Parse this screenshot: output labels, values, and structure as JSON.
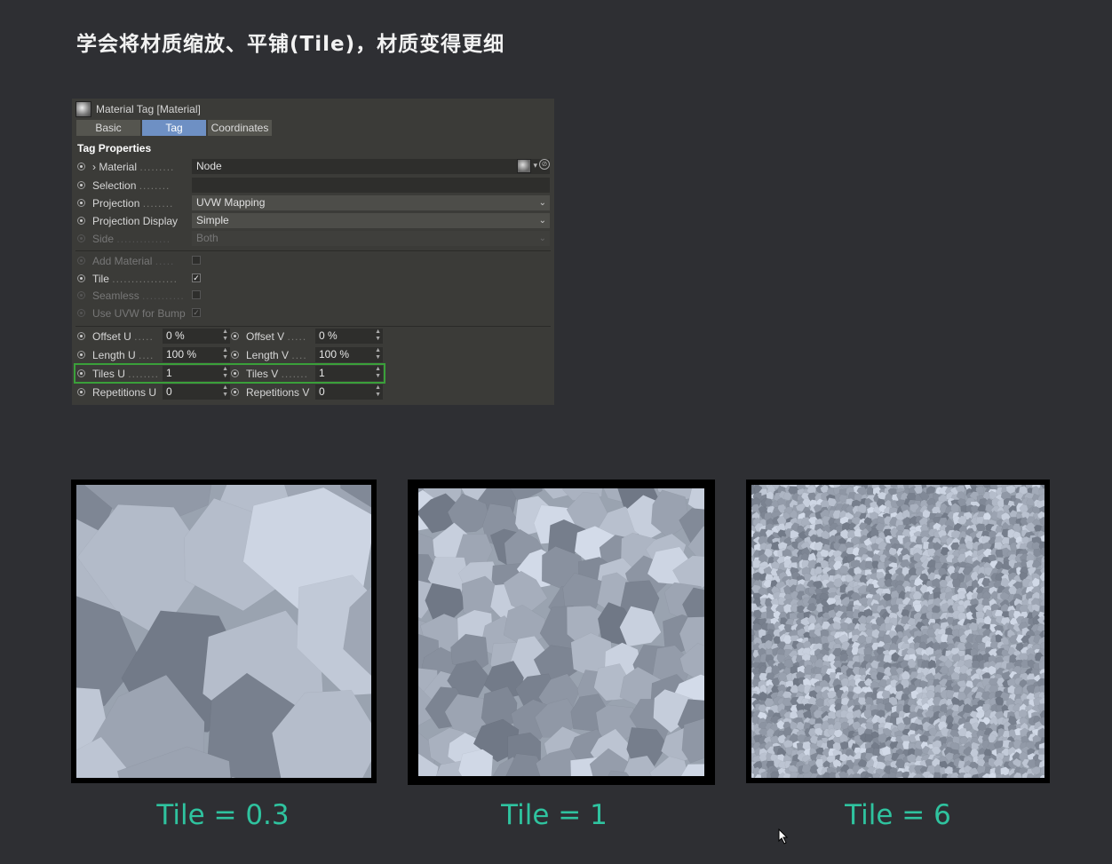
{
  "slide": {
    "title": "学会将材质缩放、平铺(Tile)，材质变得更细"
  },
  "panel": {
    "header": "Material Tag [Material]",
    "tabs": [
      {
        "label": "Basic",
        "active": false
      },
      {
        "label": "Tag",
        "active": true
      },
      {
        "label": "Coordinates",
        "active": false
      }
    ],
    "section_title": "Tag Properties",
    "material": {
      "label": "› Material",
      "value": "Node"
    },
    "selection": {
      "label": "Selection",
      "value": ""
    },
    "projection": {
      "label": "Projection",
      "value": "UVW Mapping"
    },
    "projection_display": {
      "label": "Projection Display",
      "value": "Simple"
    },
    "side": {
      "label": "Side",
      "value": "Both"
    },
    "add_material": {
      "label": "Add Material",
      "checked": false
    },
    "tile": {
      "label": "Tile",
      "checked": true
    },
    "seamless": {
      "label": "Seamless",
      "checked": false
    },
    "use_uvw_for_bump": {
      "label": "Use UVW for Bump",
      "checked": true
    },
    "offset_u": {
      "label": "Offset U",
      "value": "0 %"
    },
    "offset_v": {
      "label": "Offset V",
      "value": "0 %"
    },
    "length_u": {
      "label": "Length U",
      "value": "100 %"
    },
    "length_v": {
      "label": "Length V",
      "value": "100 %"
    },
    "tiles_u": {
      "label": "Tiles U",
      "value": "1"
    },
    "tiles_v": {
      "label": "Tiles V",
      "value": "1"
    },
    "repetitions_u": {
      "label": "Repetitions U",
      "value": "0"
    },
    "repetitions_v": {
      "label": "Repetitions V",
      "value": "0"
    }
  },
  "previews": [
    {
      "caption": "Tile = 0.3"
    },
    {
      "caption": "Tile = 1"
    },
    {
      "caption": "Tile = 6"
    }
  ],
  "colors": {
    "caption": "#2fc39f",
    "active_tab": "#6e90c4",
    "highlight": "#3aa03a"
  }
}
